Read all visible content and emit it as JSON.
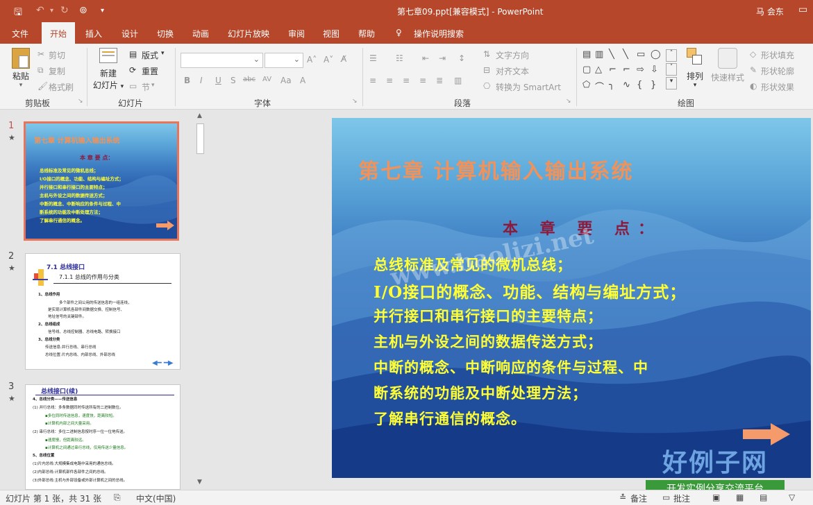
{
  "window": {
    "title": "第七章09.ppt[兼容模式]  -  PowerPoint",
    "user": "马 会东"
  },
  "tabs": [
    "文件",
    "开始",
    "插入",
    "设计",
    "切换",
    "动画",
    "幻灯片放映",
    "审阅",
    "视图",
    "帮助",
    "操作说明搜索"
  ],
  "active_tab": "开始",
  "ribbon": {
    "clipboard": {
      "paste": "粘贴",
      "cut": "剪切",
      "copy": "复制",
      "format_painter": "格式刷",
      "label": "剪贴板"
    },
    "slides": {
      "new_slide_1": "新建",
      "new_slide_2": "幻灯片",
      "layout": "版式",
      "reset": "重置",
      "section": "节",
      "label": "幻灯片"
    },
    "font": {
      "font_name": "",
      "font_size": "",
      "label": "字体"
    },
    "paragraph": {
      "text_direction": "文字方向",
      "align_text": "对齐文本",
      "convert_smartart": "转换为 SmartArt",
      "label": "段落"
    },
    "drawing": {
      "arrange": "排列",
      "quick_styles": "快速样式",
      "shape_fill": "形状填充",
      "shape_outline": "形状轮廓",
      "shape_effects": "形状效果",
      "label": "绘图"
    }
  },
  "thumbnails": [
    {
      "number": "1",
      "star": "★",
      "title": "第七章  计算机输入输出系统",
      "sub": "本 章 要 点：",
      "lines": [
        "总线标准及常见的微机总线；",
        "I/O接口的概念、功能、结构与编址方式；",
        "并行接口和串行接口的主要特点；",
        "主机与外设之间的数据传送方式；",
        "中断的概念、中断响应的条件与过程、中",
        "断系统的功能及中断处理方法；",
        "了解串行通信的概念。"
      ]
    },
    {
      "number": "2",
      "star": "★",
      "title": "7.1   总线接口",
      "sub": "7.1.1  总线的作用与分类",
      "lines": [
        "1、总线作用",
        "多个部件之间公用的传送信息的一组连线，",
        "是实现计算机各部件间数据交换、控制信号、",
        "地址信号的关键部件。",
        "2、总线组成",
        "信号线、总线控制器、总线电路、转换接口",
        "3、总线分类",
        "传送信息:并行总线、串行总线",
        "总线位置:片内总线、内部总线、外部总线"
      ]
    },
    {
      "number": "3",
      "star": "★",
      "title": "总线接口(续)",
      "lines": [
        "4、总线分类——传送信息",
        "(1)  并行总线：多条数据同时传送所有的二进制数位。",
        "▪多位同时传送信息，速度快，距离较短。",
        "▪计算机内部之间大量采用。",
        "(2)  串行总线：多位二进制信息按时序一位一位地传送。",
        "▪速度慢，但距离较远。",
        "▪计算机之间通过串行总线，仅用传送少量信息。",
        "5、总线位置",
        "(1)片内总线:大规模集成电路中采用的通信总线。",
        "(2)内部总线:计算机部件各部件之间的总线。",
        "(3)外部总线:主机与外部设备或外部计算机之间的总线。"
      ]
    }
  ],
  "slide": {
    "title": "第七章  计算机输入输出系统",
    "subtitle": "本 章 要 点：",
    "points": [
      "总线标准及常见的微机总线；",
      "I/O接口的概念、功能、结构与编址方式；",
      "并行接口和串行接口的主要特点；",
      "主机与外设之间的数据传送方式；",
      "中断的概念、中断响应的条件与过程、中",
      "断系统的功能及中断处理方法；",
      "了解串行通信的概念。"
    ]
  },
  "watermarks": {
    "site": "www.haolizi.net",
    "logo": "好例子网",
    "slogan": "开发实例分享交流平台"
  },
  "statusbar": {
    "slide_info": "幻灯片 第 1 张，共 31 张",
    "language": "中文(中国)",
    "notes": "备注",
    "comments": "批注"
  },
  "colors": {
    "accent": "#b7472a",
    "title_orange": "#f0925a",
    "sub_red": "#8b1a3c",
    "point_yellow": "#ffff33"
  }
}
